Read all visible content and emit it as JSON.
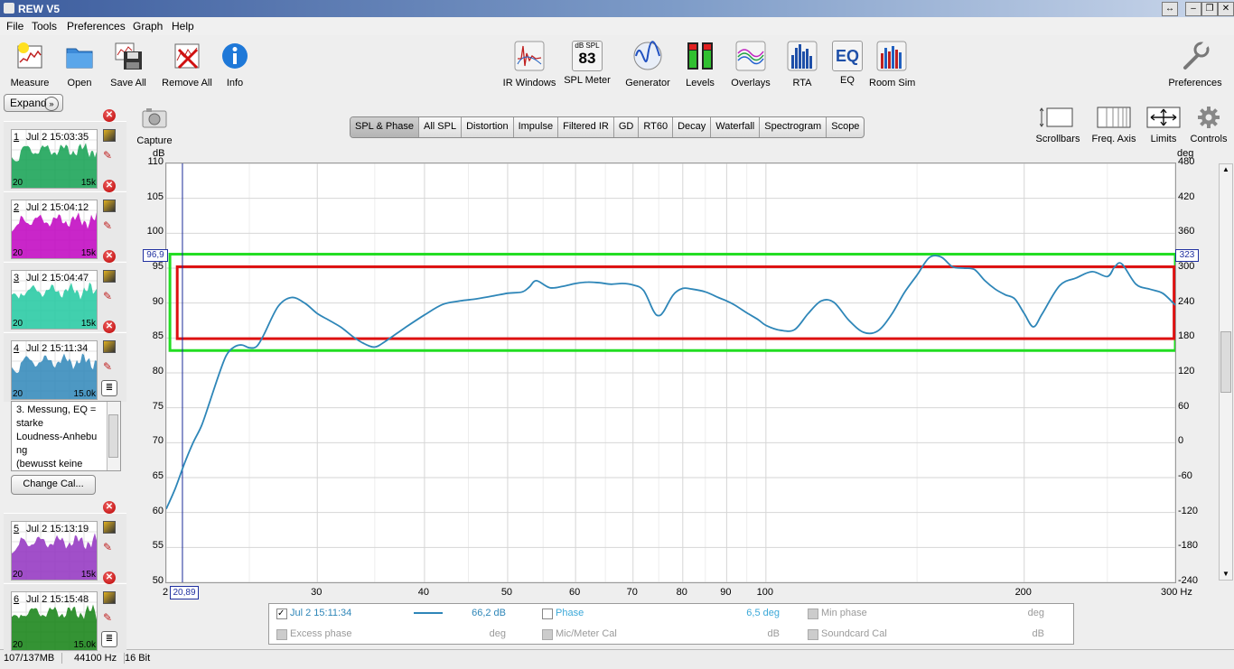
{
  "window": {
    "title": "REW V5",
    "controls": [
      "↔",
      "–",
      "❐",
      "✕"
    ]
  },
  "menu": [
    "File",
    "Tools",
    "Preferences",
    "Graph",
    "Help"
  ],
  "toolbar_left": [
    {
      "label": "Measure",
      "icon": "measure-icon"
    },
    {
      "label": "Open",
      "icon": "folder-icon"
    },
    {
      "label": "Save All",
      "icon": "save-icon"
    },
    {
      "label": "Remove All",
      "icon": "remove-icon"
    },
    {
      "label": "Info",
      "icon": "info-icon"
    }
  ],
  "toolbar_center": [
    {
      "label": "IR Windows",
      "icon": "ir-windows-icon"
    },
    {
      "label": "SPL Meter",
      "icon": "spl-meter-icon",
      "top": "dB SPL",
      "value": "83"
    },
    {
      "label": "Generator",
      "icon": "generator-icon"
    },
    {
      "label": "Levels",
      "icon": "levels-icon"
    },
    {
      "label": "Overlays",
      "icon": "overlays-icon"
    },
    {
      "label": "RTA",
      "icon": "rta-icon"
    },
    {
      "label": "EQ",
      "icon": "eq-icon",
      "text": "EQ"
    },
    {
      "label": "Room Sim",
      "icon": "room-sim-icon"
    }
  ],
  "preferences_label": "Preferences",
  "left_panel": {
    "expand_label": "Expand",
    "capture_label": "Capture",
    "measurements": [
      {
        "num": "1",
        "time": "Jul 2 15:03:35",
        "color": "#10a050",
        "f_lo": "20",
        "f_hi": "15k"
      },
      {
        "num": "2",
        "time": "Jul 2 15:04:12",
        "color": "#c000c0",
        "f_lo": "20",
        "f_hi": "15k"
      },
      {
        "num": "3",
        "time": "Jul 2 15:04:47",
        "color": "#20c8a0",
        "f_lo": "20",
        "f_hi": "15k"
      },
      {
        "num": "4",
        "time": "Jul 2 15:11:34",
        "color": "#2e86b8",
        "f_lo": "20",
        "f_hi": "15.0k"
      },
      {
        "num": "5",
        "time": "Jul 2 15:13:19",
        "color": "#9030c0",
        "f_lo": "20",
        "f_hi": "15k"
      },
      {
        "num": "6",
        "time": "Jul 2 15:15:48",
        "color": "#108010",
        "f_lo": "20",
        "f_hi": "15.0k"
      }
    ],
    "notes": [
      "3. Messung, EQ =",
      "starke",
      "Loudness-Anhebu",
      "ng",
      "(bewusst keine"
    ],
    "change_cal_label": "Change Cal..."
  },
  "tabs": [
    "SPL & Phase",
    "All SPL",
    "Distortion",
    "Impulse",
    "Filtered IR",
    "GD",
    "RT60",
    "Decay",
    "Waterfall",
    "Spectrogram",
    "Scope"
  ],
  "selected_tab": "SPL & Phase",
  "right_tools": [
    {
      "label": "Scrollbars",
      "icon": "scrollbars-icon"
    },
    {
      "label": "Freq. Axis",
      "icon": "freq-axis-icon"
    },
    {
      "label": "Limits",
      "icon": "limits-icon"
    },
    {
      "label": "Controls",
      "icon": "gear-icon"
    }
  ],
  "chart_data": {
    "type": "line",
    "ylabel": "dB",
    "y2label": "deg",
    "xunit": "Hz",
    "xscale": "log",
    "xlim": [
      20,
      300
    ],
    "ylim": [
      50,
      110
    ],
    "y2lim": [
      -240,
      480
    ],
    "x_ticks": [
      "30",
      "40",
      "50",
      "60",
      "70",
      "80",
      "90",
      "100",
      "200",
      "300 Hz"
    ],
    "x_tick_values": [
      30,
      40,
      50,
      60,
      70,
      80,
      90,
      100,
      200,
      300
    ],
    "y_ticks": [
      "110",
      "105",
      "100",
      "95",
      "90",
      "85",
      "80",
      "75",
      "70",
      "65",
      "60",
      "55",
      "50"
    ],
    "y2_ticks": [
      "480",
      "420",
      "360",
      "300",
      "240",
      "180",
      "120",
      "60",
      "0",
      "-60",
      "-120",
      "-180",
      "-240"
    ],
    "cursor": {
      "x_label": "20,89",
      "y_label": "96,9",
      "y2_label": "323",
      "x_left_label": "2"
    },
    "grid": true,
    "series": [
      {
        "name": "Jul 2 15:11:34",
        "color": "#2e86b8",
        "x": [
          20,
          20.5,
          21,
          21.5,
          22,
          22.5,
          23,
          23.5,
          24,
          24.5,
          25,
          25.5,
          26,
          27,
          28,
          29,
          30,
          31,
          32,
          33,
          34,
          35,
          36,
          38,
          40,
          42,
          44,
          46,
          48,
          50,
          52,
          53,
          54,
          56,
          58,
          60,
          62,
          64,
          66,
          68,
          70,
          72,
          74,
          75,
          76,
          78,
          80,
          82,
          85,
          88,
          90,
          92,
          95,
          98,
          100,
          104,
          108,
          112,
          116,
          120,
          125,
          130,
          135,
          140,
          145,
          150,
          155,
          160,
          165,
          170,
          175,
          180,
          185,
          190,
          195,
          200,
          205,
          210,
          220,
          230,
          240,
          250,
          255,
          260,
          270,
          280,
          290,
          300
        ],
        "y": [
          60.5,
          63.5,
          67,
          70,
          72.5,
          76,
          79.5,
          82.5,
          83.7,
          84,
          83.6,
          83.8,
          85.5,
          89.5,
          90.8,
          90.0,
          88.5,
          87.5,
          86.5,
          85.2,
          84.2,
          83.7,
          84.5,
          86.5,
          88.3,
          89.8,
          90.3,
          90.6,
          91.0,
          91.4,
          91.6,
          92.3,
          93.2,
          92.2,
          92.4,
          92.8,
          93.0,
          92.9,
          92.7,
          92.8,
          92.6,
          91.8,
          88.8,
          88.2,
          88.8,
          91.2,
          92.1,
          92.0,
          91.6,
          90.8,
          90.3,
          89.7,
          88.6,
          87.6,
          86.8,
          86.1,
          86.2,
          88.5,
          90.3,
          90.1,
          87.5,
          85.8,
          86.0,
          88.3,
          91.5,
          94.0,
          96.5,
          96.6,
          95.2,
          95.0,
          94.8,
          93.2,
          92.0,
          91.2,
          90.6,
          88.5,
          86.6,
          88.5,
          92.5,
          93.6,
          94.5,
          93.8,
          95.2,
          95.6,
          92.7,
          92.0,
          91.4,
          89.7
        ]
      }
    ],
    "annotations": [
      {
        "shape": "rect",
        "color": "#22dd22",
        "x": [
          20.2,
          300
        ],
        "y": [
          83.2,
          97.0
        ]
      },
      {
        "shape": "rect",
        "color": "#dd1111",
        "x": [
          20.6,
          299
        ],
        "y": [
          84.9,
          95.2
        ]
      }
    ]
  },
  "legend": {
    "rows": [
      [
        {
          "checked": true,
          "label": "Jul 2 15:11:34",
          "color": "#2e86b8",
          "value": "66,2 dB",
          "enabled": true
        },
        {
          "checked": false,
          "label": "Phase",
          "value": "6,5 deg",
          "enabled": true
        },
        {
          "checked": false,
          "label": "Min phase",
          "value": "deg",
          "enabled": false
        }
      ],
      [
        {
          "checked": false,
          "label": "Excess phase",
          "value": "deg",
          "enabled": false
        },
        {
          "checked": false,
          "label": "Mic/Meter Cal",
          "value": "dB",
          "enabled": false
        },
        {
          "checked": false,
          "label": "Soundcard Cal",
          "value": "dB",
          "enabled": false
        }
      ]
    ]
  },
  "status": [
    "107/137MB",
    "44100 Hz",
    "16 Bit"
  ]
}
